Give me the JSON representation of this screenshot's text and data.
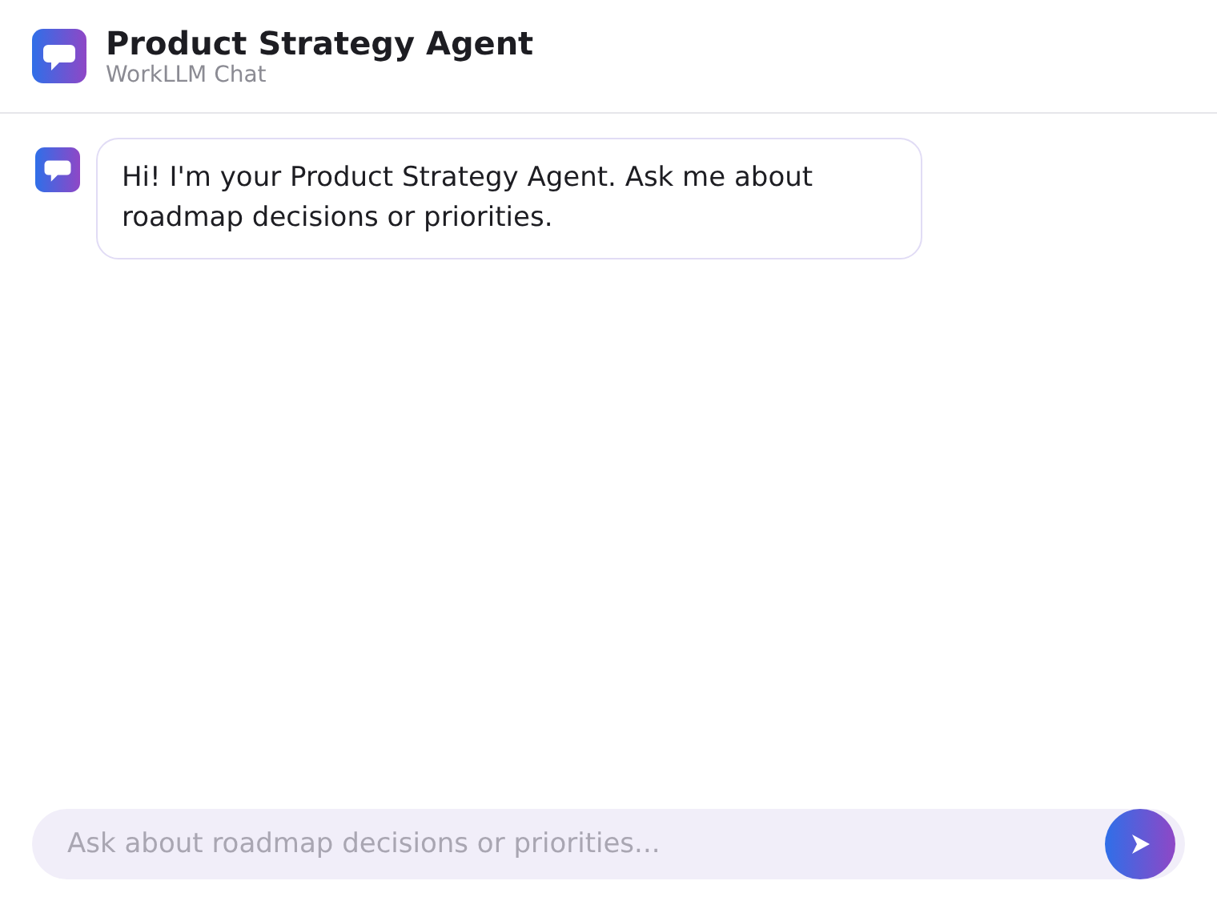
{
  "header": {
    "title": "Product Strategy Agent",
    "subtitle": "WorkLLM Chat"
  },
  "messages": [
    {
      "kind": "agent",
      "text": "Hi! I'm your Product Strategy Agent. Ask me about roadmap decisions or priorities."
    }
  ],
  "composer": {
    "placeholder": "Ask about roadmap decisions or priorities..."
  }
}
